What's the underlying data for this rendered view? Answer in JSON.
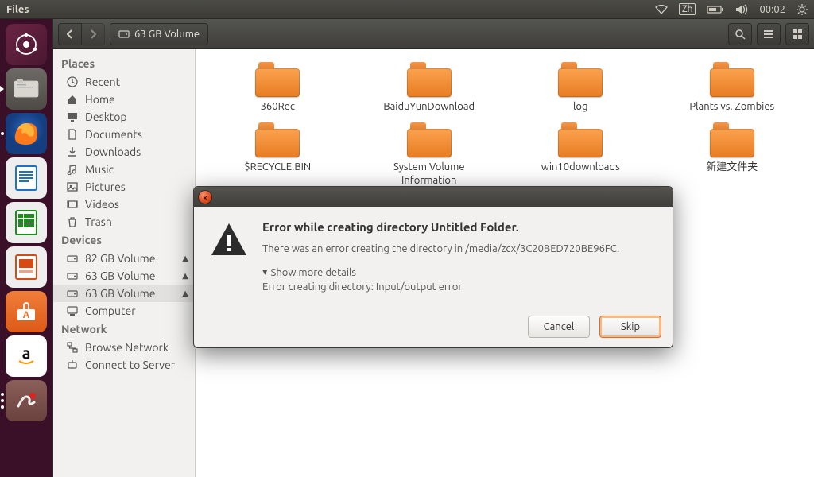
{
  "menubar": {
    "app": "Files",
    "ime": "Zh",
    "time": "00:02"
  },
  "toolbar": {
    "location_label": "63 GB Volume"
  },
  "sidebar": {
    "places_head": "Places",
    "places": [
      {
        "label": "Recent",
        "icon": "clock-icon"
      },
      {
        "label": "Home",
        "icon": "home-icon"
      },
      {
        "label": "Desktop",
        "icon": "desktop-icon"
      },
      {
        "label": "Documents",
        "icon": "document-icon"
      },
      {
        "label": "Downloads",
        "icon": "download-icon"
      },
      {
        "label": "Music",
        "icon": "music-icon"
      },
      {
        "label": "Pictures",
        "icon": "pictures-icon"
      },
      {
        "label": "Videos",
        "icon": "videos-icon"
      },
      {
        "label": "Trash",
        "icon": "trash-icon"
      }
    ],
    "devices_head": "Devices",
    "devices": [
      {
        "label": "82 GB Volume",
        "eject": true,
        "selected": false
      },
      {
        "label": "63 GB Volume",
        "eject": true,
        "selected": false
      },
      {
        "label": "63 GB Volume",
        "eject": true,
        "selected": true
      },
      {
        "label": "Computer",
        "eject": false,
        "selected": false
      }
    ],
    "network_head": "Network",
    "network": [
      {
        "label": "Browse Network"
      },
      {
        "label": "Connect to Server"
      }
    ]
  },
  "folders": [
    {
      "name": "360Rec"
    },
    {
      "name": "BaiduYunDownload"
    },
    {
      "name": "log"
    },
    {
      "name": "Plants vs. Zombies"
    },
    {
      "name": "$RECYCLE.BIN"
    },
    {
      "name": "System Volume Information"
    },
    {
      "name": "win10downloads"
    },
    {
      "name": "新建文件夹"
    }
  ],
  "dialog": {
    "title": "Error while creating directory Untitled Folder.",
    "message": "There was an error creating the directory in /media/zcx/3C20BED720BE96FC.",
    "expander": "Show more details",
    "detail": "Error creating directory: Input/output error",
    "cancel": "Cancel",
    "skip": "Skip"
  }
}
